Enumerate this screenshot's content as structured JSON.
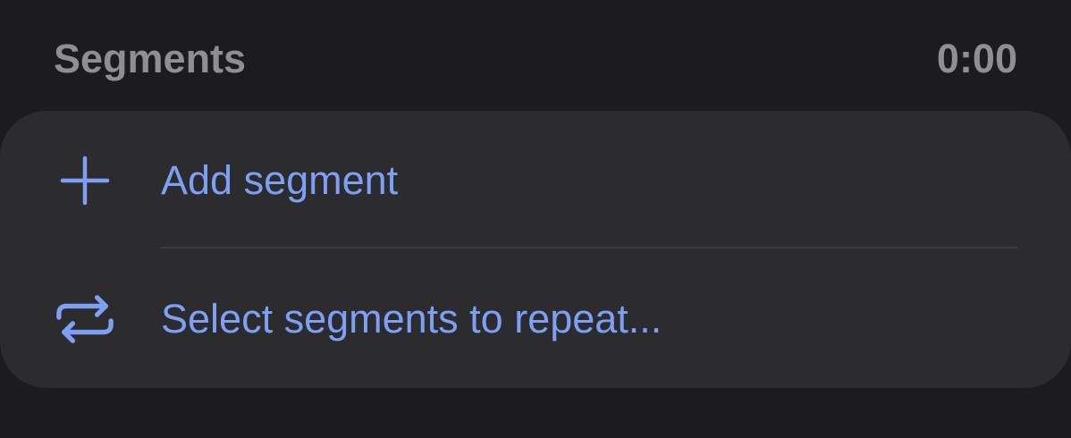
{
  "section": {
    "title": "Segments",
    "duration": "0:00"
  },
  "actions": [
    {
      "label": "Add segment",
      "icon": "plus-icon"
    },
    {
      "label": "Select segments to repeat...",
      "icon": "repeat-icon"
    }
  ],
  "colors": {
    "accent": "#7d9ff5",
    "background": "#1c1c1e",
    "card": "#2c2c2e",
    "header_text": "#8e8e93"
  }
}
